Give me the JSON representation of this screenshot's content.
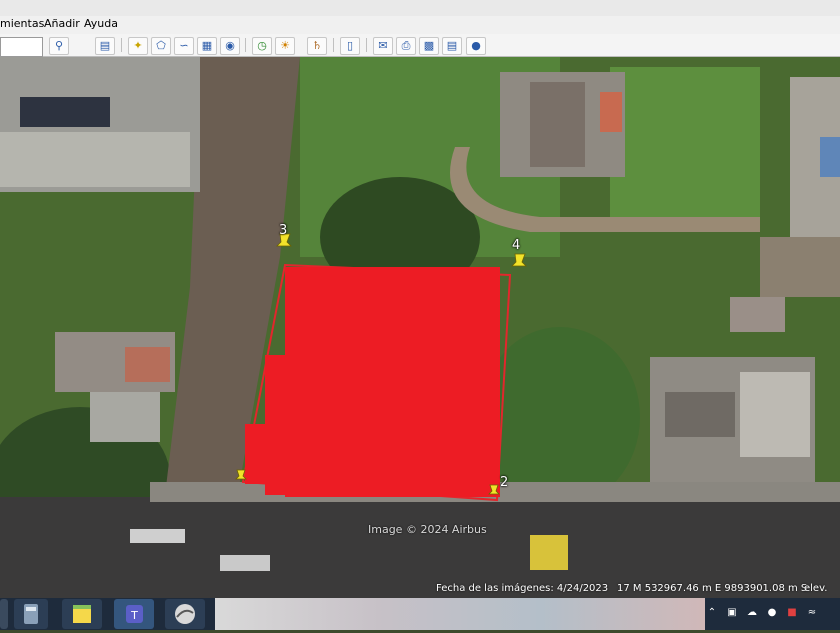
{
  "menu": {
    "items": [
      "mientas",
      "Añadir",
      "Ayuda"
    ]
  },
  "toolbar": {
    "search_placeholder": "",
    "buttons": [
      "search-icon",
      "sidebar-icon",
      "placemark-icon",
      "polygon-icon",
      "path-icon",
      "image-overlay-icon",
      "record-tour-icon",
      "history-icon",
      "sunlight-icon",
      "planets-icon",
      "ruler-icon",
      "email-icon",
      "print-icon",
      "save-image-icon",
      "view-in-maps-icon",
      "globe-icon"
    ]
  },
  "map": {
    "pins": [
      {
        "label": "3"
      },
      {
        "label": "4"
      },
      {
        "label": "2"
      }
    ],
    "redaction_color": "#ed1c24",
    "credit": "Image © 2024 Airbus",
    "imagery_date": "Fecha de las imágenes: 4/24/2023",
    "coordinates": "17 M 532967.46 m E 9893901.08 m S",
    "elevation": "elev."
  },
  "taskbar": {
    "apps": [
      "calculator-icon",
      "sticky-notes-icon",
      "teams-icon",
      "google-earth-pro-icon"
    ],
    "tray": [
      "chevron-up-icon",
      "car-icon",
      "onedrive-icon",
      "teams-tray-icon",
      "defender-icon",
      "wifi-icon"
    ]
  }
}
